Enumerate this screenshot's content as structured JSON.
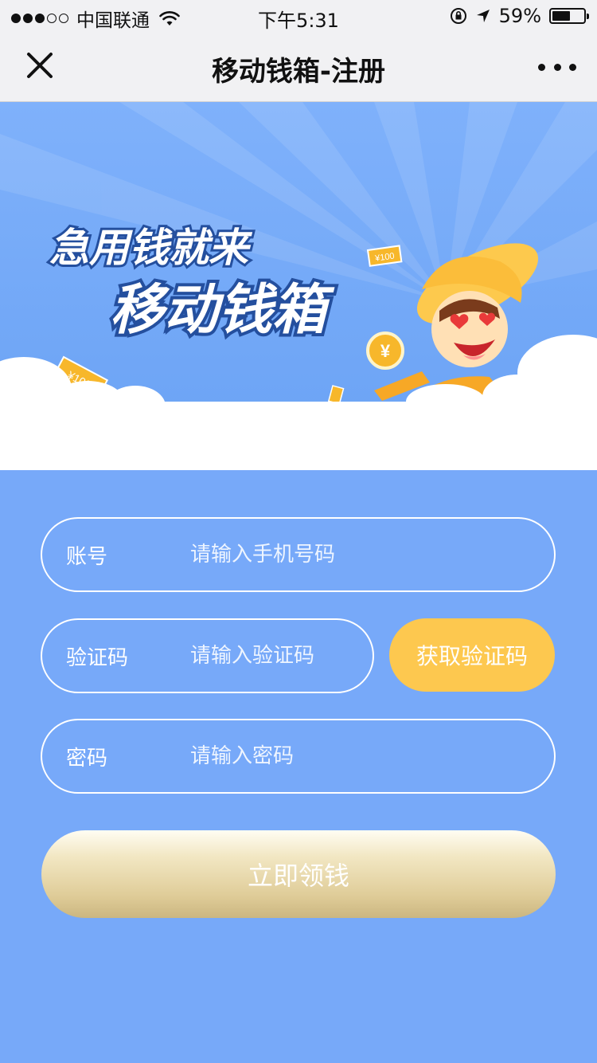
{
  "status_bar": {
    "carrier": "中国联通",
    "time": "下午5:31",
    "battery_percent": "59%",
    "battery_level": 0.59
  },
  "nav": {
    "title": "移动钱箱-注册",
    "close_icon": "close-icon",
    "more_icon": "more-icon"
  },
  "banner": {
    "line1": "急用钱就来",
    "line2": "移动钱箱",
    "note_label": "¥100",
    "coin_label": "¥"
  },
  "form": {
    "account": {
      "label": "账号",
      "placeholder": "请输入手机号码",
      "value": ""
    },
    "code": {
      "label": "验证码",
      "placeholder": "请输入验证码",
      "value": ""
    },
    "get_code_label": "获取验证码",
    "password": {
      "label": "密码",
      "placeholder": "请输入密码",
      "value": ""
    },
    "submit_label": "立即领钱"
  },
  "colors": {
    "page_bg": "#77a9f9",
    "banner_bg": "#77aaf7",
    "code_button": "#fdc84f",
    "submit_gradient_top": "#fffdf3",
    "submit_gradient_bottom": "#cbb680"
  }
}
